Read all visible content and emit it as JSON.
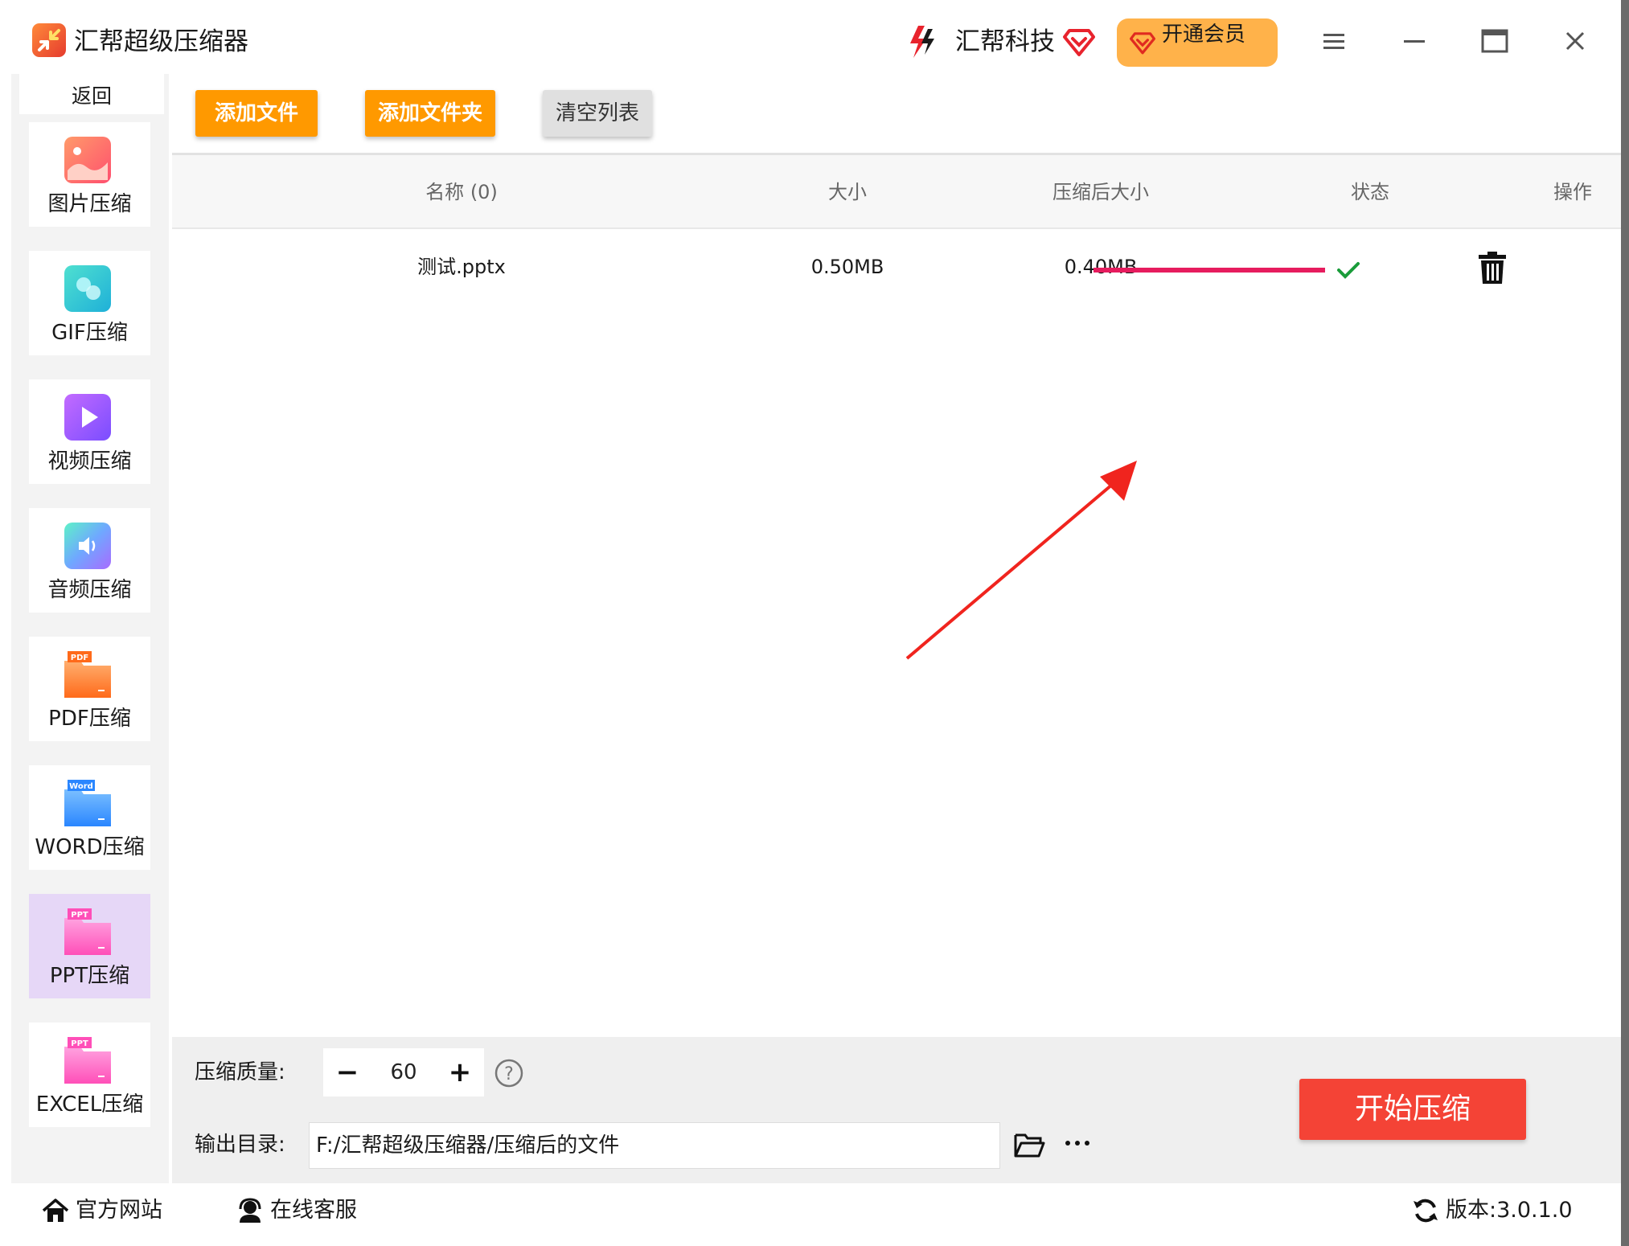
{
  "app": {
    "title": "汇帮超级压缩器",
    "brand": "汇帮科技",
    "vip_label": "开通会员"
  },
  "sidebar": {
    "back_label": "返回",
    "items": [
      {
        "label": "图片压缩",
        "icon": "image-icon"
      },
      {
        "label": "GIF压缩",
        "icon": "gif-icon"
      },
      {
        "label": "视频压缩",
        "icon": "video-icon"
      },
      {
        "label": "音频压缩",
        "icon": "audio-icon"
      },
      {
        "label": "PDF压缩",
        "icon": "pdf-icon",
        "badge": "PDF"
      },
      {
        "label": "WORD压缩",
        "icon": "word-icon",
        "badge": "Word"
      },
      {
        "label": "PPT压缩",
        "icon": "ppt-icon",
        "badge": "PPT",
        "active": true
      },
      {
        "label": "EXCEL压缩",
        "icon": "excel-icon",
        "badge": "PPT"
      }
    ]
  },
  "toolbar": {
    "add_file": "添加文件",
    "add_folder": "添加文件夹",
    "clear_list": "清空列表"
  },
  "table": {
    "headers": {
      "name": "名称 (0)",
      "size": "大小",
      "compressed_size": "压缩后大小",
      "status": "状态",
      "action": "操作"
    },
    "rows": [
      {
        "name": "测试.pptx",
        "size": "0.50MB",
        "compressed_size": "0.40MB",
        "progress": 1.0,
        "status": "done"
      }
    ]
  },
  "settings": {
    "quality_label": "压缩质量:",
    "quality_value": "60",
    "output_label": "输出目录:",
    "output_path": "F:/汇帮超级压缩器/压缩后的文件",
    "start_label": "开始压缩"
  },
  "footer": {
    "website": "官方网站",
    "support": "在线客服",
    "version": "版本:3.0.1.0"
  },
  "colors": {
    "accent_orange": "#ff9900",
    "start_red": "#f44336",
    "progress": "#e61c5e",
    "vip_bg": "#ffb24a"
  }
}
